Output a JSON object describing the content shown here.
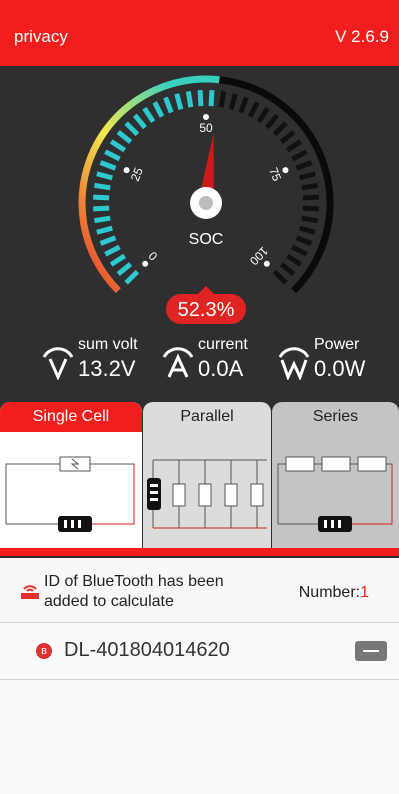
{
  "header": {
    "title": "privacy",
    "version": "V 2.6.9"
  },
  "gauge": {
    "value_percent": 52.3,
    "value_text": "52.3%",
    "center_label": "SOC",
    "ticks": [
      "0",
      "25",
      "50",
      "75",
      "100"
    ],
    "colors": {
      "gradient_start": "#e52d27",
      "gradient_mid": "#f6e94b",
      "gradient_end": "#3ad0c0",
      "active_ticks": "#2ec8d0",
      "inactive_ticks": "#111111",
      "needle": "#cc1a1a",
      "badge": "#e02424"
    }
  },
  "metrics": [
    {
      "icon": "v-icon",
      "label": "sum volt",
      "value": "13.2V"
    },
    {
      "icon": "a-icon",
      "label": "current",
      "value": "0.0A"
    },
    {
      "icon": "w-icon",
      "label": "Power",
      "value": "0.0W"
    }
  ],
  "modes": {
    "single": "Single Cell",
    "parallel": "Parallel",
    "series": "Series",
    "active": "single"
  },
  "info": {
    "text": "ID of BlueTooth has been added to calculate",
    "number_label": "Number:",
    "number_value": "1"
  },
  "device": {
    "name": "DL-401804014620"
  }
}
